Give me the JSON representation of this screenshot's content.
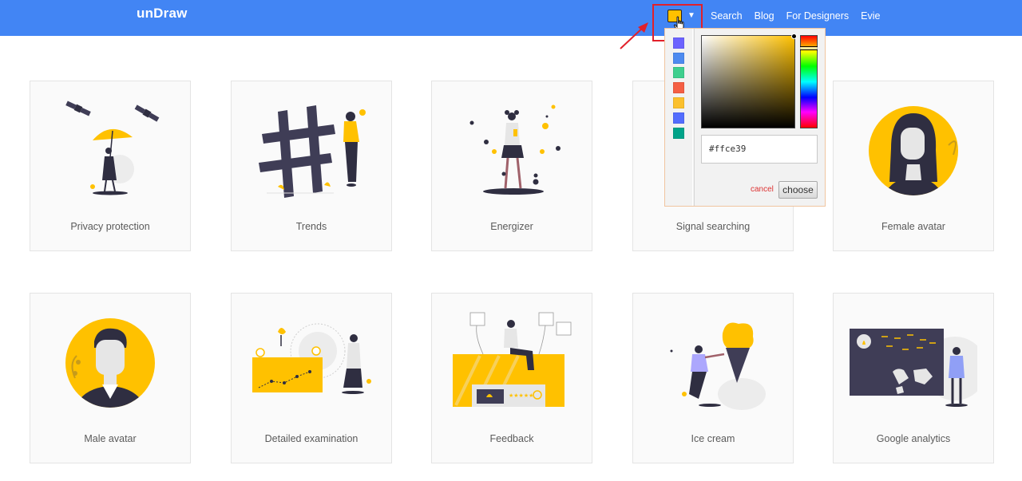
{
  "app": {
    "logo": "unDraw"
  },
  "nav": {
    "links": [
      "Search",
      "Blog",
      "For Designers",
      "Evie"
    ]
  },
  "color_picker": {
    "current_color": "#ffc100",
    "hex_value": "#ffce39",
    "hue_color": "#ffc100",
    "swatches": [
      "#6c63ff",
      "#4d8af0",
      "#3ecf8e",
      "#f55f44",
      "#fbc02d",
      "#536dfe",
      "#00a389"
    ],
    "cancel_label": "cancel",
    "choose_label": "choose"
  },
  "cards": [
    {
      "label": "Privacy protection",
      "illustration": "woman-umbrella-satellites"
    },
    {
      "label": "Trends",
      "illustration": "hashtag-woman"
    },
    {
      "label": "Energizer",
      "illustration": "woman-drink-dots"
    },
    {
      "label": "Signal searching",
      "illustration": "signal"
    },
    {
      "label": "Female avatar",
      "illustration": "female-avatar"
    },
    {
      "label": "Male avatar",
      "illustration": "male-avatar"
    },
    {
      "label": "Detailed examination",
      "illustration": "woman-chart-magnify"
    },
    {
      "label": "Feedback",
      "illustration": "woman-sitting-feedback"
    },
    {
      "label": "Ice cream",
      "illustration": "man-ice-cream"
    },
    {
      "label": "Google analytics",
      "illustration": "man-dashboard-map"
    }
  ],
  "colors": {
    "accent": "#4285f4",
    "brand_yellow": "#ffc100",
    "dark": "#2f2e41",
    "annotation": "#e2202a"
  }
}
